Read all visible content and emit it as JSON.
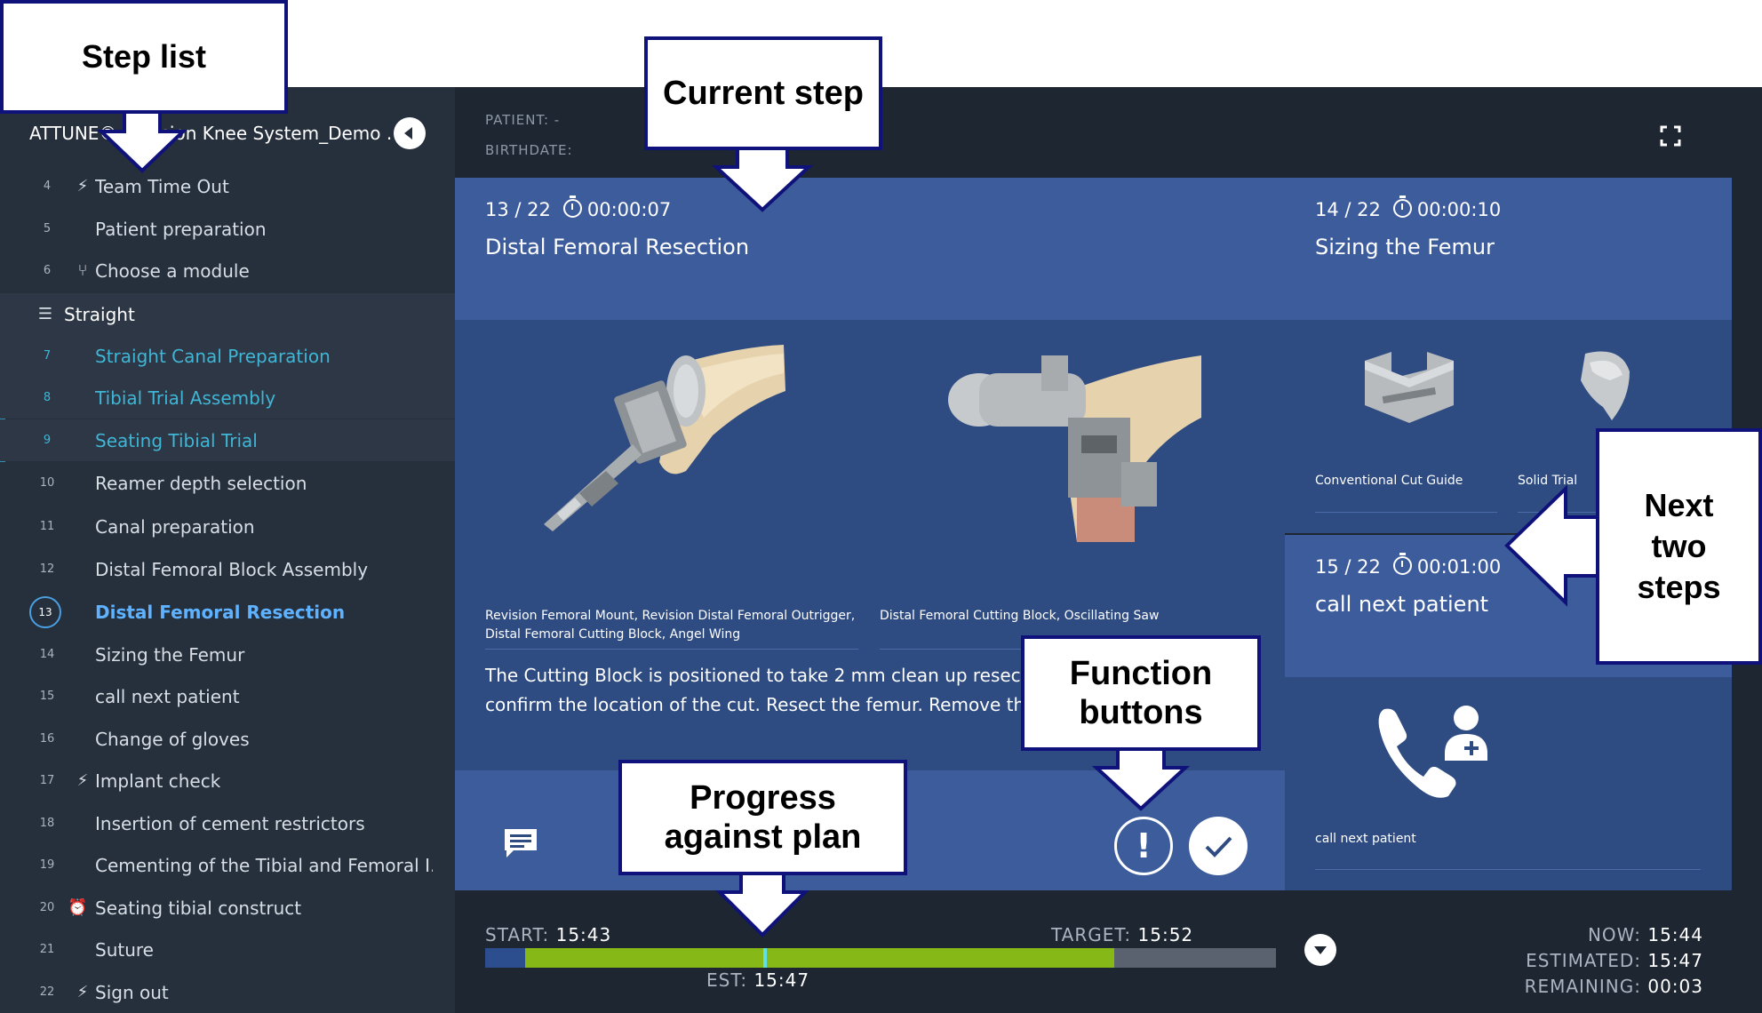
{
  "sidebar": {
    "title": "ATTUNE® Revision Knee System_Demo ...",
    "steps": [
      {
        "num": "4",
        "label": "Team Time Out",
        "icon": "lightning-icon"
      },
      {
        "num": "5",
        "label": "Patient preparation",
        "icon": ""
      },
      {
        "num": "6",
        "label": "Choose a module",
        "icon": "branch-icon"
      },
      {
        "num": "",
        "label": "Straight",
        "icon": "list-indent-icon"
      },
      {
        "num": "7",
        "label": "Straight Canal Preparation",
        "icon": ""
      },
      {
        "num": "8",
        "label": "Tibial Trial Assembly",
        "icon": ""
      },
      {
        "num": "9",
        "label": "Seating Tibial Trial",
        "icon": ""
      },
      {
        "num": "10",
        "label": "Reamer depth selection",
        "icon": ""
      },
      {
        "num": "11",
        "label": "Canal preparation",
        "icon": ""
      },
      {
        "num": "12",
        "label": "Distal Femoral Block Assembly",
        "icon": ""
      },
      {
        "num": "13",
        "label": "Distal Femoral Resection",
        "icon": ""
      },
      {
        "num": "14",
        "label": "Sizing the Femur",
        "icon": ""
      },
      {
        "num": "15",
        "label": "call next patient",
        "icon": ""
      },
      {
        "num": "16",
        "label": "Change of gloves",
        "icon": ""
      },
      {
        "num": "17",
        "label": "Implant check",
        "icon": "lightning-icon"
      },
      {
        "num": "18",
        "label": "Insertion of cement restrictors",
        "icon": ""
      },
      {
        "num": "19",
        "label": "Cementing of the Tibial and Femoral I...",
        "icon": ""
      },
      {
        "num": "20",
        "label": "Seating tibial construct",
        "icon": "alarm-clock-icon"
      },
      {
        "num": "21",
        "label": "Suture",
        "icon": ""
      },
      {
        "num": "22",
        "label": "Sign out",
        "icon": "lightning-icon"
      }
    ]
  },
  "header": {
    "patient_label": "PATIENT: -",
    "birthdate_label": "BIRTHDATE:"
  },
  "current_step": {
    "index": "13 / 22",
    "timer": "00:00:07",
    "name": "Distal Femoral Resection",
    "image1_caption": "Revision Femoral Mount, Revision Distal Femoral Outrigger, Distal Femoral Cutting Block, Angel Wing",
    "image2_caption": "Distal Femoral Cutting Block, Oscillating Saw",
    "description": "The Cutting Block is positioned to take 2 mm clean up resection. Use an Angel Wing to confirm the location of the cut. Resect the femur. Remove the Cutting Block and Pins."
  },
  "next_steps": [
    {
      "index": "14 / 22",
      "timer": "00:00:10",
      "name": "Sizing the Femur",
      "captions": [
        "Conventional Cut Guide",
        "Solid Trial"
      ]
    },
    {
      "index": "15 / 22",
      "timer": "00:01:00",
      "name": "call next patient",
      "captions": [
        "call next patient"
      ]
    }
  ],
  "progress": {
    "start_label": "START:",
    "start_time": "15:43",
    "target_label": "TARGET:",
    "target_time": "15:52",
    "est_label": "EST:",
    "est_time": "15:47",
    "start_fraction": 0.05,
    "fill_fraction": 0.795,
    "est_fraction": 0.352
  },
  "times": {
    "now_label": "NOW:",
    "now_time": "15:44",
    "estimated_label": "ESTIMATED:",
    "estimated_time": "15:47",
    "remaining_label": "REMAINING:",
    "remaining_time": "00:03"
  },
  "callouts": {
    "step_list": "Step list",
    "current_step": "Current step",
    "next_two_steps": [
      "Next",
      "two",
      "steps"
    ],
    "function_buttons": [
      "Function",
      "buttons"
    ],
    "progress_against_plan": [
      "Progress",
      "against plan"
    ]
  },
  "colors": {
    "background": "#1e2632",
    "sidebar": "#262f3c",
    "card": "#2e4b82",
    "card_header": "#3d5c9c",
    "accent_cyan": "#3fb6d6",
    "progress_green": "#86b817",
    "callout_border": "#0f127a"
  }
}
